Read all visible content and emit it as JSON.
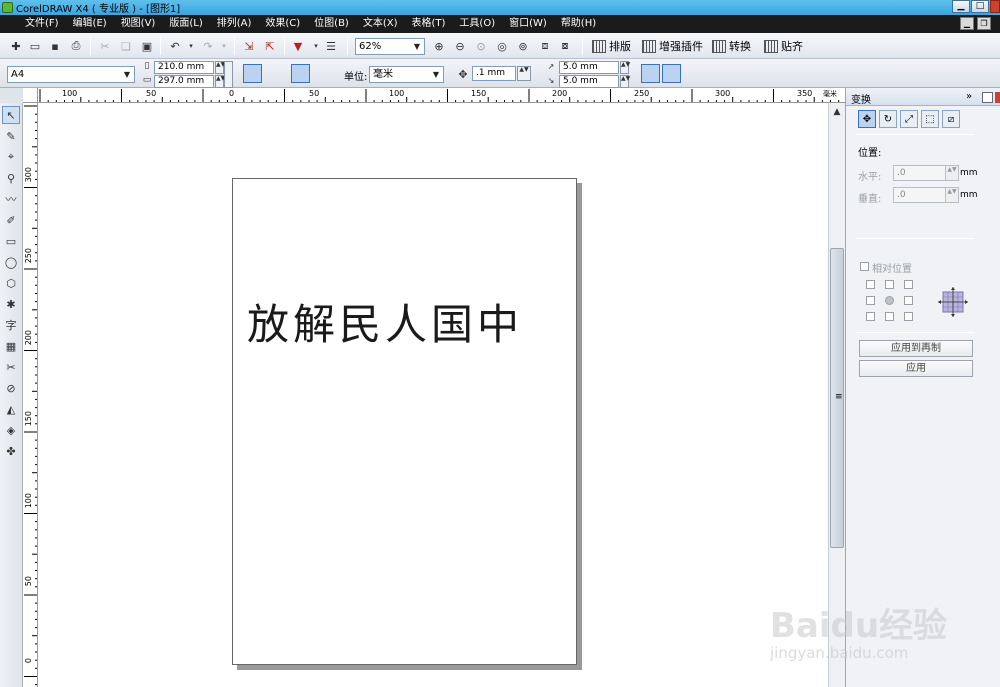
{
  "window": {
    "title": "CorelDRAW X4 ( 专业版 ) - [图形1]",
    "min_glyph": "▁",
    "max_glyph": "□",
    "close_glyph": "✕"
  },
  "menu": [
    "文件(F)",
    "编辑(E)",
    "视图(V)",
    "版面(L)",
    "排列(A)",
    "效果(C)",
    "位图(B)",
    "文本(X)",
    "表格(T)",
    "工具(O)",
    "窗口(W)",
    "帮助(H)"
  ],
  "mdi": {
    "min_glyph": "▁",
    "restore_glyph": "❐"
  },
  "toolbar": {
    "zoom_value": "62%",
    "plugin_buttons": [
      "排版",
      "增强插件",
      "转换",
      "贴齐"
    ]
  },
  "property_bar": {
    "paper_size": "A4",
    "width": "210.0 mm",
    "height": "297.0 mm",
    "units_label": "单位:",
    "units_value": "毫米",
    "nudge": ".1 mm",
    "dup_x": "5.0 mm",
    "dup_y": "5.0 mm"
  },
  "rulers": {
    "corner_glyph": "px",
    "unit_glyph": "毫米",
    "h_labels": [
      "100",
      "50",
      "0",
      "50",
      "100",
      "150",
      "200",
      "250",
      "300",
      "350"
    ],
    "v_labels": [
      "300",
      "250",
      "200",
      "150",
      "100",
      "50",
      "0"
    ]
  },
  "toolbox": [
    "↖",
    "✎",
    "⌖",
    "⚲",
    "〰",
    "✐",
    "▭",
    "◯",
    "⬡",
    "✱",
    "字",
    "▦",
    "✂",
    "⊘",
    "◭",
    "◈",
    "✤"
  ],
  "canvas": {
    "page_text": "放解民人国中"
  },
  "docker": {
    "title": "变换",
    "collapse_glyph": "»",
    "tabs": [
      "✥",
      "↻",
      "⤢",
      "⬚",
      "⧄"
    ],
    "position_label": "位置:",
    "h_label": "水平:",
    "h_value": ".0",
    "h_unit": "mm",
    "v_label": "垂直:",
    "v_value": ".0",
    "v_unit": "mm",
    "relative_label": "相对位置",
    "apply_dup_label": "应用到再制",
    "apply_label": "应用"
  },
  "watermark": {
    "brand": "Baidu经验",
    "url": "jingyan.baidu.com"
  }
}
